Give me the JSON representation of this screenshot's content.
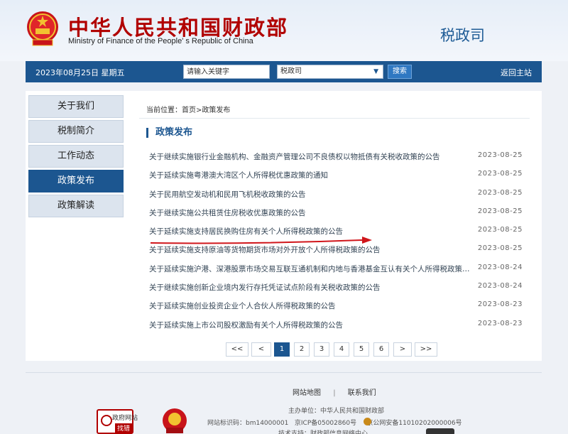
{
  "header": {
    "title_cn": "中华人民共和国财政部",
    "title_en": "Ministry of Finance of the People' s Republic of China",
    "department": "税政司"
  },
  "topbar": {
    "date": "2023年08月25日 星期五",
    "search_placeholder": "请输入关键字",
    "select_value": "税政司",
    "search_label": "搜索",
    "home_label": "返回主站"
  },
  "sidebar": {
    "items": [
      {
        "label": "关于我们"
      },
      {
        "label": "税制简介"
      },
      {
        "label": "工作动态"
      },
      {
        "label": "政策发布"
      },
      {
        "label": "政策解读"
      }
    ],
    "active_index": 3
  },
  "breadcrumb": "当前位置：首页>政策发布",
  "section_title": "政策发布",
  "articles": [
    {
      "title": "关于继续实施银行业金融机构、金融资产管理公司不良债权以物抵债有关税收政策的公告",
      "date": "2023-08-25"
    },
    {
      "title": "关于延续实施粤港澳大湾区个人所得税优惠政策的通知",
      "date": "2023-08-25"
    },
    {
      "title": "关于民用航空发动机和民用飞机税收政策的公告",
      "date": "2023-08-25"
    },
    {
      "title": "关于继续实施公共租赁住房税收优惠政策的公告",
      "date": "2023-08-25"
    },
    {
      "title": "关于延续实施支持居民换购住房有关个人所得税政策的公告",
      "date": "2023-08-25"
    },
    {
      "title": "关于延续实施支持原油等货物期货市场对外开放个人所得税政策的公告",
      "date": "2023-08-25"
    },
    {
      "title": "关于延续实施沪港、深港股票市场交易互联互通机制和内地与香港基金互认有关个人所得税政策的公告",
      "date": "2023-08-24"
    },
    {
      "title": "关于继续实施创新企业境内发行存托凭证试点阶段有关税收政策的公告",
      "date": "2023-08-24"
    },
    {
      "title": "关于延续实施创业投资企业个人合伙人所得税政策的公告",
      "date": "2023-08-23"
    },
    {
      "title": "关于延续实施上市公司股权激励有关个人所得税政策的公告",
      "date": "2023-08-23"
    }
  ],
  "pager": {
    "first": "<<",
    "prev": "<",
    "pages": [
      "1",
      "2",
      "3",
      "4",
      "5",
      "6"
    ],
    "current": "1",
    "next": ">",
    "last": ">>"
  },
  "footer": {
    "sitemap": "网站地图",
    "separator": "|",
    "contact": "联系我们",
    "sponsor": "主办单位：中华人民共和国财政部",
    "site_id": "网站标识码：bm14000001",
    "icp": "京ICP备05002860号",
    "police": "京公网安备11010202000006号",
    "support": "技术支持：财政部信息网络中心",
    "badge_line1": "政府网站",
    "badge_line2": "找错"
  },
  "colors": {
    "brand_red": "#b10000",
    "brand_blue": "#1c5690",
    "annotation_red": "#d0161b"
  }
}
